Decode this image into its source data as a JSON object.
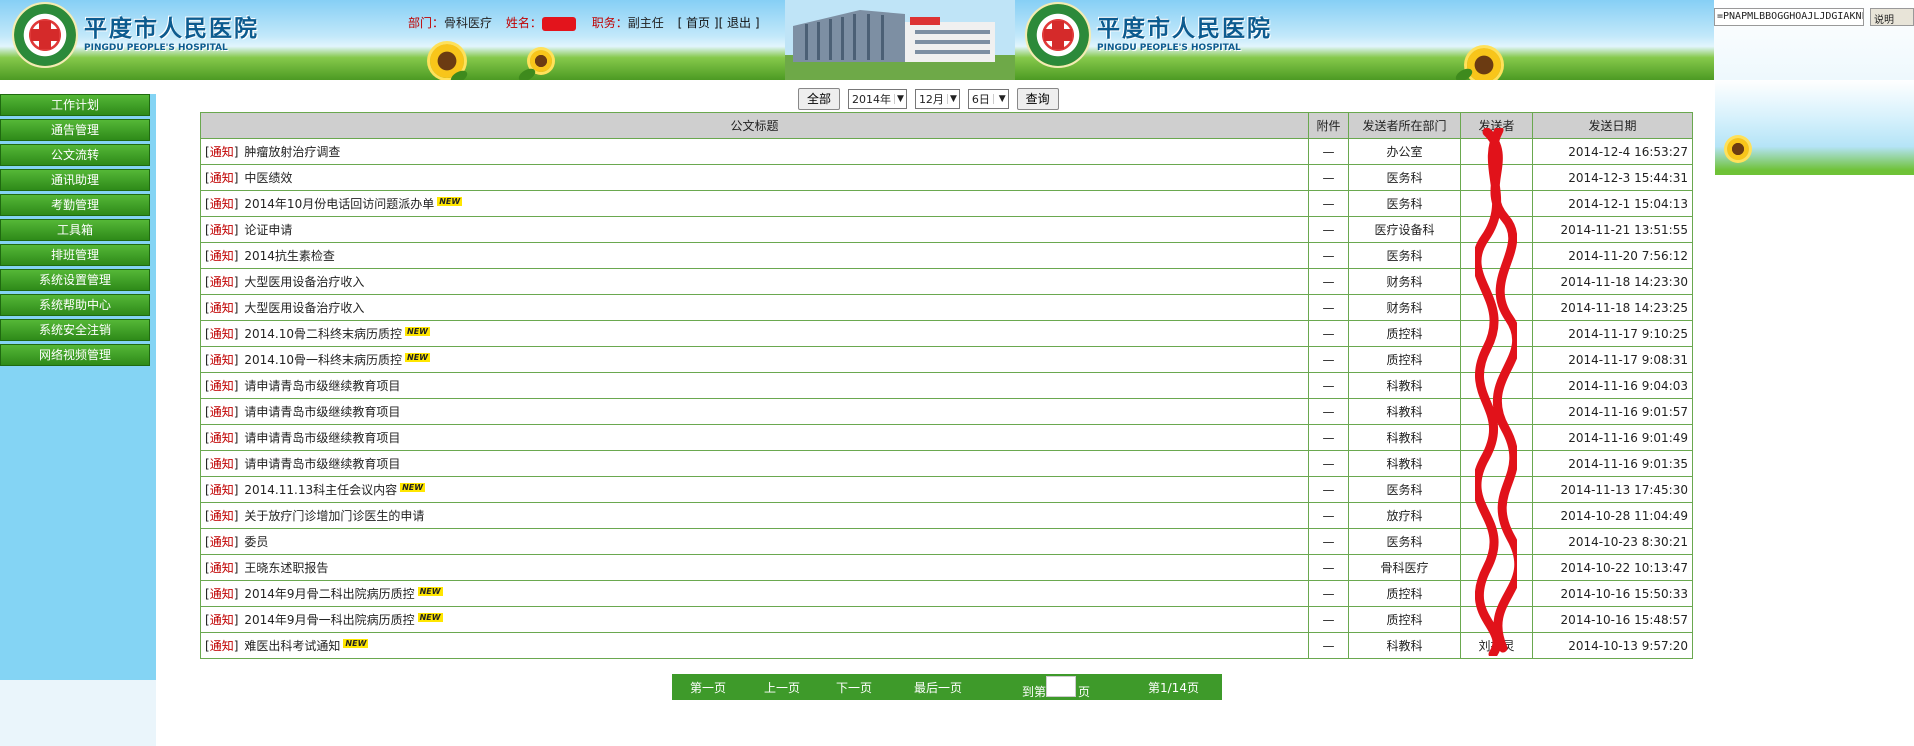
{
  "header": {
    "hospital_name": "平度市人民医院",
    "hospital_name_en": "PINGDU PEOPLE'S HOSPITAL",
    "dept_label": "部门：",
    "dept_value": "骨科医疗",
    "name_label": "姓名：",
    "role_label": "职务：",
    "role_value": "副主任",
    "home_link": "[ 首页 ]",
    "exit_link": "[ 退出 ]",
    "code_text": "=PNAPMLBBOGGHOAJLJDGIAKNF",
    "code_button": "说明"
  },
  "sidebar": {
    "items": [
      {
        "label": "工作计划"
      },
      {
        "label": "通告管理"
      },
      {
        "label": "公文流转"
      },
      {
        "label": "通讯助理"
      },
      {
        "label": "考勤管理"
      },
      {
        "label": "工具箱"
      },
      {
        "label": "排班管理"
      },
      {
        "label": "系统设置管理"
      },
      {
        "label": "系统帮助中心"
      },
      {
        "label": "系统安全注销"
      },
      {
        "label": "网络视频管理"
      }
    ]
  },
  "filter": {
    "all_label": "全部",
    "year": "2014年",
    "month": "12月",
    "day": "6日",
    "query_label": "查询"
  },
  "table": {
    "headers": [
      "公文标题",
      "附件",
      "发送者所在部门",
      "发送者",
      "发送日期"
    ],
    "rows": [
      {
        "tag": "通知",
        "title": "肿瘤放射治疗调查",
        "new": false,
        "attach": "—",
        "dept": "办公室",
        "sender": "",
        "date": "2014-12-4 16:53:27"
      },
      {
        "tag": "通知",
        "title": "中医绩效",
        "new": false,
        "attach": "—",
        "dept": "医务科",
        "sender": "",
        "date": "2014-12-3 15:44:31"
      },
      {
        "tag": "通知",
        "title": "2014年10月份电话回访问题派办单",
        "new": true,
        "attach": "—",
        "dept": "医务科",
        "sender": "",
        "date": "2014-12-1 15:04:13"
      },
      {
        "tag": "通知",
        "title": "论证申请",
        "new": false,
        "attach": "—",
        "dept": "医疗设备科",
        "sender": "",
        "date": "2014-11-21 13:51:55"
      },
      {
        "tag": "通知",
        "title": "2014抗生素检查",
        "new": false,
        "attach": "—",
        "dept": "医务科",
        "sender": "",
        "date": "2014-11-20 7:56:12"
      },
      {
        "tag": "通知",
        "title": "大型医用设备治疗收入",
        "new": false,
        "attach": "—",
        "dept": "财务科",
        "sender": "",
        "date": "2014-11-18 14:23:30"
      },
      {
        "tag": "通知",
        "title": "大型医用设备治疗收入",
        "new": false,
        "attach": "—",
        "dept": "财务科",
        "sender": "",
        "date": "2014-11-18 14:23:25"
      },
      {
        "tag": "通知",
        "title": "2014.10骨二科终末病历质控",
        "new": true,
        "attach": "—",
        "dept": "质控科",
        "sender": "",
        "date": "2014-11-17 9:10:25"
      },
      {
        "tag": "通知",
        "title": "2014.10骨一科终末病历质控",
        "new": true,
        "attach": "—",
        "dept": "质控科",
        "sender": "",
        "date": "2014-11-17 9:08:31"
      },
      {
        "tag": "通知",
        "title": "请申请青岛市级继续教育项目",
        "new": false,
        "attach": "—",
        "dept": "科教科",
        "sender": "",
        "date": "2014-11-16 9:04:03"
      },
      {
        "tag": "通知",
        "title": "请申请青岛市级继续教育项目",
        "new": false,
        "attach": "—",
        "dept": "科教科",
        "sender": "",
        "date": "2014-11-16 9:01:57"
      },
      {
        "tag": "通知",
        "title": "请申请青岛市级继续教育项目",
        "new": false,
        "attach": "—",
        "dept": "科教科",
        "sender": "",
        "date": "2014-11-16 9:01:49"
      },
      {
        "tag": "通知",
        "title": "请申请青岛市级继续教育项目",
        "new": false,
        "attach": "—",
        "dept": "科教科",
        "sender": "",
        "date": "2014-11-16 9:01:35"
      },
      {
        "tag": "通知",
        "title": "2014.11.13科主任会议内容",
        "new": true,
        "attach": "—",
        "dept": "医务科",
        "sender": "",
        "date": "2014-11-13 17:45:30"
      },
      {
        "tag": "通知",
        "title": "关于放疗门诊增加门诊医生的申请",
        "new": false,
        "attach": "—",
        "dept": "放疗科",
        "sender": "",
        "date": "2014-10-28 11:04:49"
      },
      {
        "tag": "通知",
        "title": "委员",
        "new": false,
        "attach": "—",
        "dept": "医务科",
        "sender": "",
        "date": "2014-10-23 8:30:21"
      },
      {
        "tag": "通知",
        "title": "王晓东述职报告",
        "new": false,
        "attach": "—",
        "dept": "骨科医疗",
        "sender": "",
        "date": "2014-10-22 10:13:47"
      },
      {
        "tag": "通知",
        "title": "2014年9月骨二科出院病历质控",
        "new": true,
        "attach": "—",
        "dept": "质控科",
        "sender": "",
        "date": "2014-10-16 15:50:33"
      },
      {
        "tag": "通知",
        "title": "2014年9月骨一科出院病历质控",
        "new": true,
        "attach": "—",
        "dept": "质控科",
        "sender": "",
        "date": "2014-10-16 15:48:57"
      },
      {
        "tag": "通知",
        "title": "难医出科考试通知",
        "new": true,
        "attach": "—",
        "dept": "科教科",
        "sender": "刘振灵",
        "date": "2014-10-13 9:57:20"
      }
    ],
    "new_badge": "NEW"
  },
  "pager": {
    "first": "第一页",
    "prev": "上一页",
    "next": "下一页",
    "last": "最后一页",
    "goto_prefix": "到第",
    "goto_suffix": "页",
    "page_info": "第1/14页"
  }
}
